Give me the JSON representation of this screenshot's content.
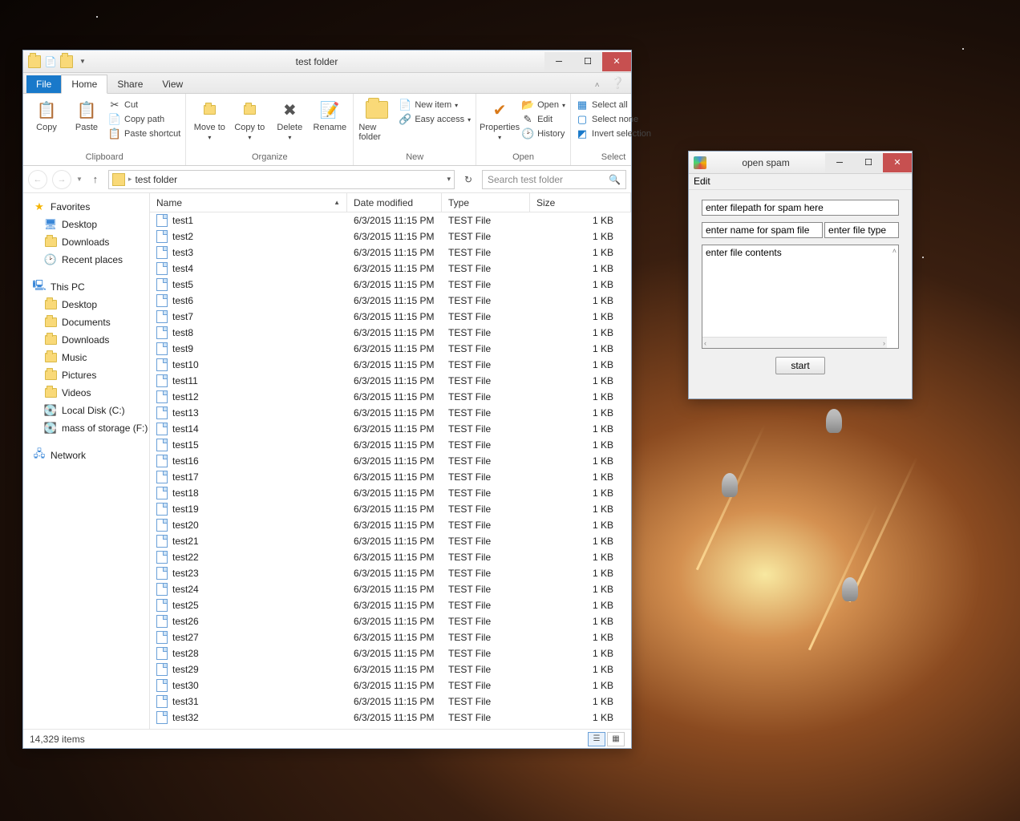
{
  "explorer": {
    "title": "test folder",
    "tabs": {
      "file": "File",
      "home": "Home",
      "share": "Share",
      "view": "View"
    },
    "ribbon": {
      "clipboard": {
        "label": "Clipboard",
        "copy": "Copy",
        "paste": "Paste",
        "cut": "Cut",
        "copy_path": "Copy path",
        "paste_shortcut": "Paste shortcut"
      },
      "organize": {
        "label": "Organize",
        "move_to": "Move to",
        "copy_to": "Copy to",
        "delete": "Delete",
        "rename": "Rename"
      },
      "new": {
        "label": "New",
        "new_folder": "New folder",
        "new_item": "New item",
        "easy_access": "Easy access"
      },
      "open": {
        "label": "Open",
        "properties": "Properties",
        "open": "Open",
        "edit": "Edit",
        "history": "History"
      },
      "select": {
        "label": "Select",
        "select_all": "Select all",
        "select_none": "Select none",
        "invert": "Invert selection"
      }
    },
    "address": {
      "path": "test folder"
    },
    "search": {
      "placeholder": "Search test folder"
    },
    "sidebar": {
      "favorites": {
        "label": "Favorites",
        "items": [
          "Desktop",
          "Downloads",
          "Recent places"
        ]
      },
      "this_pc": {
        "label": "This PC",
        "items": [
          "Desktop",
          "Documents",
          "Downloads",
          "Music",
          "Pictures",
          "Videos",
          "Local Disk (C:)",
          "mass of storage (F:)"
        ]
      },
      "network": {
        "label": "Network"
      }
    },
    "columns": {
      "name": "Name",
      "date": "Date modified",
      "type": "Type",
      "size": "Size"
    },
    "files": [
      {
        "name": "test1",
        "date": "6/3/2015 11:15 PM",
        "type": "TEST File",
        "size": "1 KB"
      },
      {
        "name": "test2",
        "date": "6/3/2015 11:15 PM",
        "type": "TEST File",
        "size": "1 KB"
      },
      {
        "name": "test3",
        "date": "6/3/2015 11:15 PM",
        "type": "TEST File",
        "size": "1 KB"
      },
      {
        "name": "test4",
        "date": "6/3/2015 11:15 PM",
        "type": "TEST File",
        "size": "1 KB"
      },
      {
        "name": "test5",
        "date": "6/3/2015 11:15 PM",
        "type": "TEST File",
        "size": "1 KB"
      },
      {
        "name": "test6",
        "date": "6/3/2015 11:15 PM",
        "type": "TEST File",
        "size": "1 KB"
      },
      {
        "name": "test7",
        "date": "6/3/2015 11:15 PM",
        "type": "TEST File",
        "size": "1 KB"
      },
      {
        "name": "test8",
        "date": "6/3/2015 11:15 PM",
        "type": "TEST File",
        "size": "1 KB"
      },
      {
        "name": "test9",
        "date": "6/3/2015 11:15 PM",
        "type": "TEST File",
        "size": "1 KB"
      },
      {
        "name": "test10",
        "date": "6/3/2015 11:15 PM",
        "type": "TEST File",
        "size": "1 KB"
      },
      {
        "name": "test11",
        "date": "6/3/2015 11:15 PM",
        "type": "TEST File",
        "size": "1 KB"
      },
      {
        "name": "test12",
        "date": "6/3/2015 11:15 PM",
        "type": "TEST File",
        "size": "1 KB"
      },
      {
        "name": "test13",
        "date": "6/3/2015 11:15 PM",
        "type": "TEST File",
        "size": "1 KB"
      },
      {
        "name": "test14",
        "date": "6/3/2015 11:15 PM",
        "type": "TEST File",
        "size": "1 KB"
      },
      {
        "name": "test15",
        "date": "6/3/2015 11:15 PM",
        "type": "TEST File",
        "size": "1 KB"
      },
      {
        "name": "test16",
        "date": "6/3/2015 11:15 PM",
        "type": "TEST File",
        "size": "1 KB"
      },
      {
        "name": "test17",
        "date": "6/3/2015 11:15 PM",
        "type": "TEST File",
        "size": "1 KB"
      },
      {
        "name": "test18",
        "date": "6/3/2015 11:15 PM",
        "type": "TEST File",
        "size": "1 KB"
      },
      {
        "name": "test19",
        "date": "6/3/2015 11:15 PM",
        "type": "TEST File",
        "size": "1 KB"
      },
      {
        "name": "test20",
        "date": "6/3/2015 11:15 PM",
        "type": "TEST File",
        "size": "1 KB"
      },
      {
        "name": "test21",
        "date": "6/3/2015 11:15 PM",
        "type": "TEST File",
        "size": "1 KB"
      },
      {
        "name": "test22",
        "date": "6/3/2015 11:15 PM",
        "type": "TEST File",
        "size": "1 KB"
      },
      {
        "name": "test23",
        "date": "6/3/2015 11:15 PM",
        "type": "TEST File",
        "size": "1 KB"
      },
      {
        "name": "test24",
        "date": "6/3/2015 11:15 PM",
        "type": "TEST File",
        "size": "1 KB"
      },
      {
        "name": "test25",
        "date": "6/3/2015 11:15 PM",
        "type": "TEST File",
        "size": "1 KB"
      },
      {
        "name": "test26",
        "date": "6/3/2015 11:15 PM",
        "type": "TEST File",
        "size": "1 KB"
      },
      {
        "name": "test27",
        "date": "6/3/2015 11:15 PM",
        "type": "TEST File",
        "size": "1 KB"
      },
      {
        "name": "test28",
        "date": "6/3/2015 11:15 PM",
        "type": "TEST File",
        "size": "1 KB"
      },
      {
        "name": "test29",
        "date": "6/3/2015 11:15 PM",
        "type": "TEST File",
        "size": "1 KB"
      },
      {
        "name": "test30",
        "date": "6/3/2015 11:15 PM",
        "type": "TEST File",
        "size": "1 KB"
      },
      {
        "name": "test31",
        "date": "6/3/2015 11:15 PM",
        "type": "TEST File",
        "size": "1 KB"
      },
      {
        "name": "test32",
        "date": "6/3/2015 11:15 PM",
        "type": "TEST File",
        "size": "1 KB"
      }
    ],
    "status": {
      "item_count": "14,329 items"
    }
  },
  "dialog": {
    "title": "open spam",
    "menu": {
      "edit": "Edit"
    },
    "fields": {
      "filepath_placeholder": "enter filepath for spam here",
      "filename_placeholder": "enter name for spam file",
      "filetype_placeholder": "enter file type",
      "contents_placeholder": "enter file contents"
    },
    "start_button": "start"
  }
}
